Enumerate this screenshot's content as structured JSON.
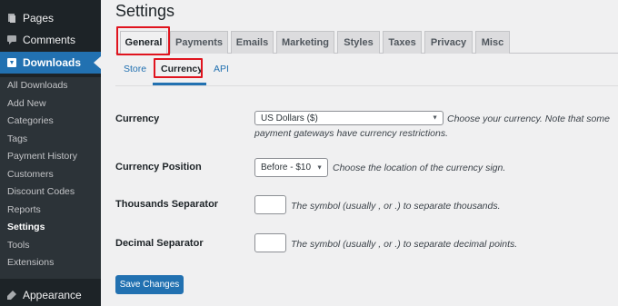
{
  "sidebar": {
    "pages_label": "Pages",
    "comments_label": "Comments",
    "downloads_label": "Downloads",
    "appearance_label": "Appearance",
    "submenu": [
      "All Downloads",
      "Add New",
      "Categories",
      "Tags",
      "Payment History",
      "Customers",
      "Discount Codes",
      "Reports",
      "Settings",
      "Tools",
      "Extensions"
    ],
    "current_submenu": "Settings"
  },
  "page": {
    "title": "Settings",
    "tabs": [
      "General",
      "Payments",
      "Emails",
      "Marketing",
      "Styles",
      "Taxes",
      "Privacy",
      "Misc"
    ],
    "active_tab": "General",
    "subtabs": [
      "Store",
      "Currency",
      "API"
    ],
    "active_subtab": "Currency"
  },
  "form": {
    "currency": {
      "label": "Currency",
      "value": "US Dollars ($)",
      "description_line1": "Choose your currency. Note that some",
      "description_line2": "payment gateways have currency restrictions."
    },
    "currency_position": {
      "label": "Currency Position",
      "value": "Before - $10",
      "description": "Choose the location of the currency sign."
    },
    "thousands_separator": {
      "label": "Thousands Separator",
      "value": "",
      "description": "The symbol (usually , or .) to separate thousands."
    },
    "decimal_separator": {
      "label": "Decimal Separator",
      "value": "",
      "description": "The symbol (usually , or .) to separate decimal points."
    },
    "save_label": "Save Changes"
  },
  "colors": {
    "admin_bar": "#1d2327",
    "accent": "#2271b1",
    "highlight": "#e0141e"
  },
  "icons": [
    "pages-icon",
    "comments-icon",
    "downloads-icon",
    "appearance-icon"
  ]
}
